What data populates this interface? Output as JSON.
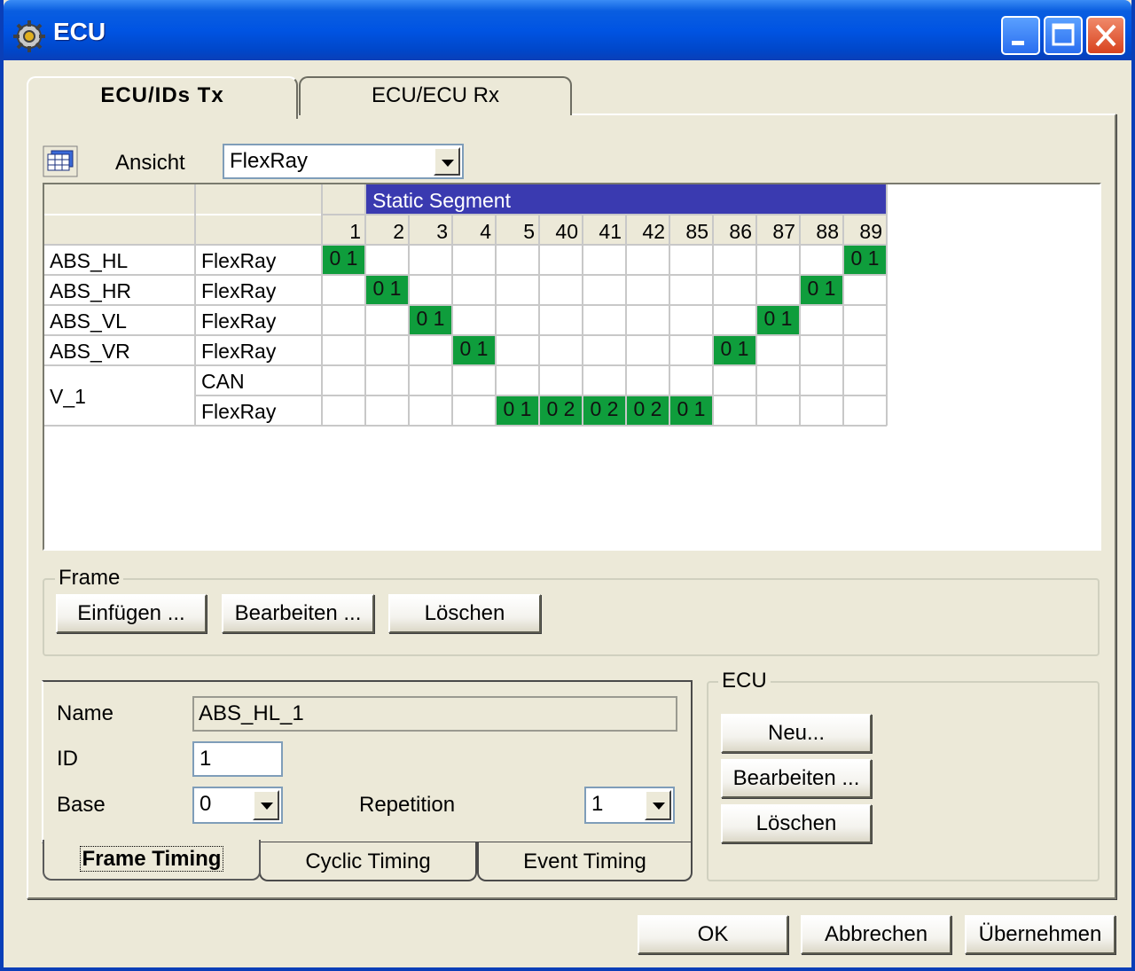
{
  "window": {
    "title": "ECU",
    "app_icon": "gear-icon"
  },
  "tabs": [
    {
      "label": "ECU/IDs Tx",
      "active": true
    },
    {
      "label": "ECU/ECU Rx",
      "active": false
    }
  ],
  "view": {
    "label": "Ansicht",
    "value": "FlexRay",
    "icon": "table-view-icon"
  },
  "grid": {
    "segment_label": "Static Segment",
    "slots": [
      "1",
      "2",
      "3",
      "4",
      "5",
      "40",
      "41",
      "42",
      "85",
      "86",
      "87",
      "88",
      "89"
    ],
    "rows": [
      {
        "ecu": "ABS_HL",
        "bus": "FlexRay",
        "cells": {
          "1": "0 1",
          "89": "0 1"
        }
      },
      {
        "ecu": "ABS_HR",
        "bus": "FlexRay",
        "cells": {
          "2": "0 1",
          "88": "0 1"
        }
      },
      {
        "ecu": "ABS_VL",
        "bus": "FlexRay",
        "cells": {
          "3": "0 1",
          "87": "0 1"
        }
      },
      {
        "ecu": "ABS_VR",
        "bus": "FlexRay",
        "cells": {
          "4": "0 1",
          "86": "0 1"
        }
      },
      {
        "ecu": "V_1",
        "bus": "CAN",
        "cells": {}
      },
      {
        "ecu": "",
        "bus": "FlexRay",
        "cells": {
          "5": "0 1",
          "40": "0 2",
          "41": "0 2",
          "42": "0 2",
          "85": "0 1"
        }
      }
    ],
    "colors": {
      "header": "#3a3ab0",
      "active_cell": "#0f9d3c",
      "gridline": "#c8c8c8"
    }
  },
  "frame_group": {
    "label": "Frame",
    "buttons": {
      "insert": "Einfügen ...",
      "edit": "Bearbeiten ...",
      "delete": "Löschen"
    }
  },
  "frame_details": {
    "name_label": "Name",
    "name_value": "ABS_HL_1",
    "id_label": "ID",
    "id_value": "1",
    "base_label": "Base",
    "base_value": "0",
    "repetition_label": "Repetition",
    "repetition_value": "1",
    "subtabs": [
      "Frame Timing",
      "Cyclic Timing",
      "Event Timing"
    ]
  },
  "ecu_group": {
    "label": "ECU",
    "buttons": {
      "new": "Neu...",
      "edit": "Bearbeiten ...",
      "delete": "Löschen"
    }
  },
  "dialog_buttons": {
    "ok": "OK",
    "cancel": "Abbrechen",
    "apply": "Übernehmen"
  }
}
